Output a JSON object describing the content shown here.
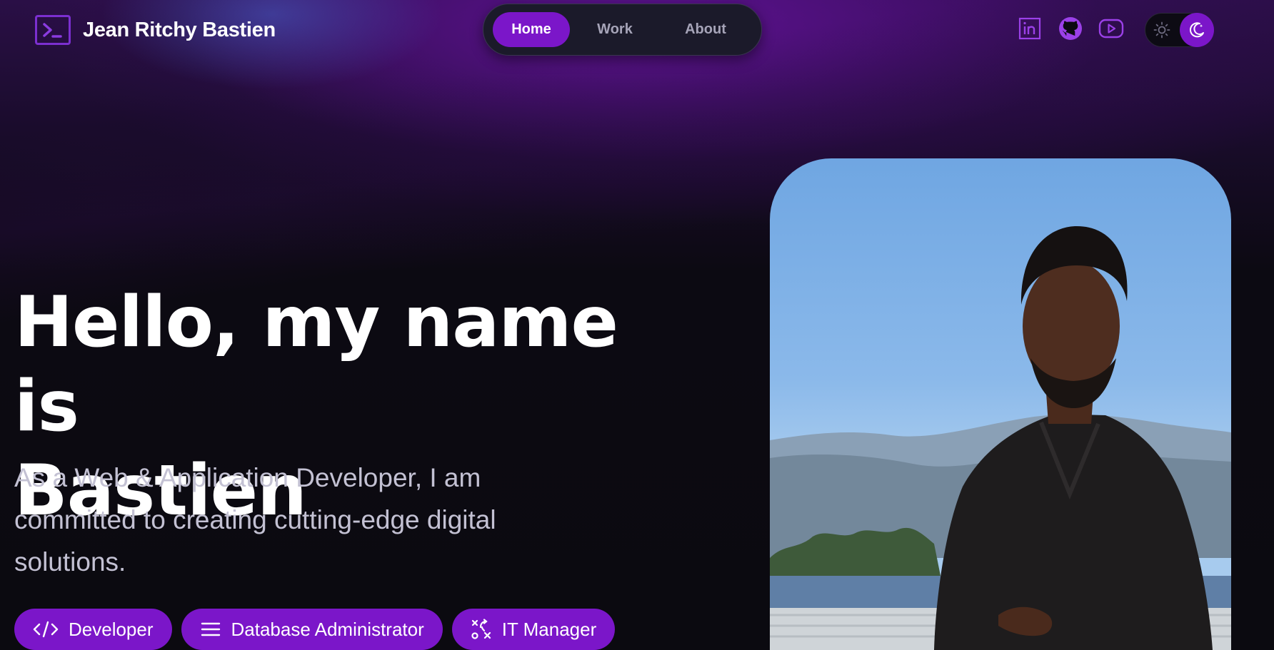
{
  "brand": {
    "name": "Jean Ritchy Bastien",
    "logo_icon": "terminal-icon"
  },
  "nav": {
    "items": [
      {
        "label": "Home",
        "active": true
      },
      {
        "label": "Work",
        "active": false
      },
      {
        "label": "About",
        "active": false
      }
    ]
  },
  "socials": [
    {
      "icon": "linkedin-icon"
    },
    {
      "icon": "github-icon"
    },
    {
      "icon": "youtube-icon"
    }
  ],
  "theme": {
    "mode": "dark",
    "light_icon": "sun-icon",
    "dark_icon": "moon-icon"
  },
  "hero": {
    "title_line1": "Hello, my name is",
    "title_line2": "Bastien",
    "subtitle": "As a Web & Application Developer, I am committed to creating cutting-edge digital solutions.",
    "roles": [
      {
        "label": "Developer",
        "icon": "code-icon"
      },
      {
        "label": "Database Administrator",
        "icon": "menu-lines-icon"
      },
      {
        "label": "IT Manager",
        "icon": "strategy-icon"
      }
    ]
  },
  "colors": {
    "accent": "#7b16c9",
    "background": "#0c0a12",
    "subtitle": "#c3c1d3"
  }
}
